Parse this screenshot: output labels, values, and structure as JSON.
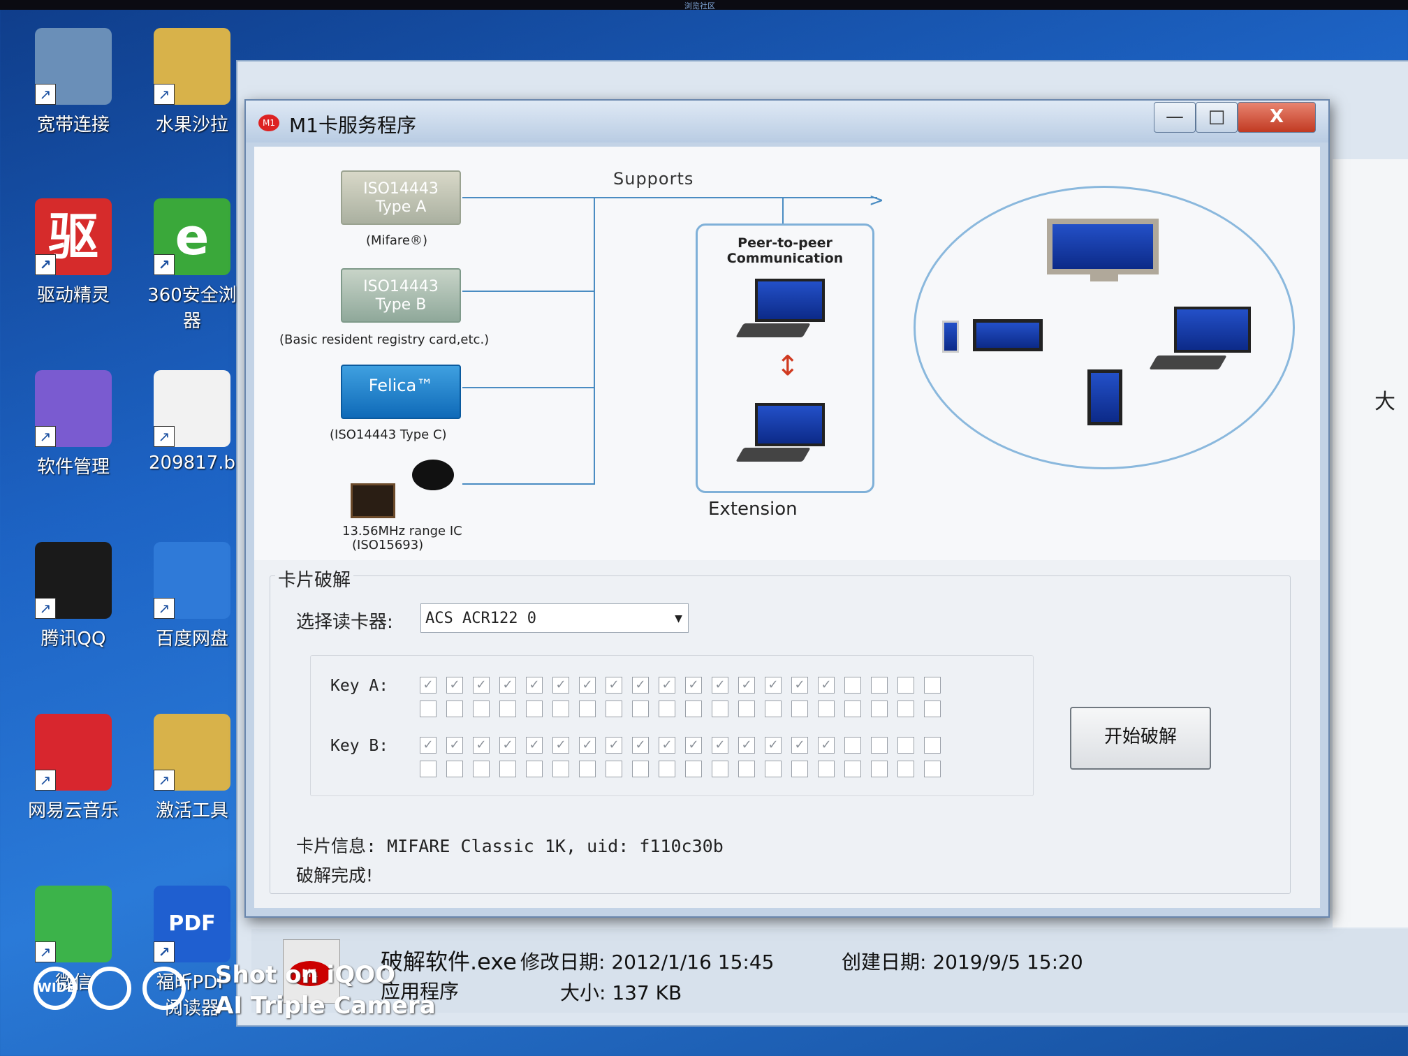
{
  "topbar_text": "浏览社区",
  "desktop": {
    "icons": [
      {
        "label": "宽带连接",
        "icon": "network-icon"
      },
      {
        "label": "水果沙拉",
        "icon": "folder-icon"
      },
      {
        "label": "驱动精灵",
        "icon": "driver-app-icon",
        "glyph": "驱"
      },
      {
        "label": "360安全浏",
        "label2": "器",
        "icon": "browser-360-icon",
        "glyph": "e"
      },
      {
        "label": "软件管理",
        "icon": "software-manager-icon"
      },
      {
        "label": "209817.b",
        "icon": "file-icon"
      },
      {
        "label": "腾讯QQ",
        "icon": "qq-icon"
      },
      {
        "label": "百度网盘",
        "icon": "baidu-netdisk-icon"
      },
      {
        "label": "网易云音乐",
        "icon": "netease-music-icon"
      },
      {
        "label": "激活工具",
        "icon": "folder-icon"
      },
      {
        "label": "微信",
        "icon": "wechat-icon"
      },
      {
        "label": "福昕PDF",
        "label2": "阅读器",
        "icon": "pdf-reader-icon",
        "glyph": "PDF"
      }
    ]
  },
  "background_window": {
    "side_char": "大"
  },
  "dialog": {
    "title": "M1卡服务程序",
    "app_icon": "card-app-icon",
    "window_buttons": {
      "minimize": "—",
      "maximize": "□",
      "close": "X"
    },
    "banner": {
      "supports": "Supports",
      "tags": [
        {
          "text1": "ISO14443",
          "text2": "Type A",
          "caption": "(Mifare®)"
        },
        {
          "text1": "ISO14443",
          "text2": "Type B",
          "caption": "(Basic resident registry card,etc.)"
        },
        {
          "text1": "Felica™",
          "caption": "(ISO14443 Type C)"
        }
      ],
      "ic_caption_1": "13.56MHz range IC",
      "ic_caption_2": "(ISO15693)",
      "p2p_1": "Peer-to-peer",
      "p2p_2": "Communication",
      "extension": "Extension"
    },
    "crack": {
      "group_title": "卡片破解",
      "reader_label": "选择读卡器:",
      "reader_value": "ACS ACR122 0",
      "key_a_label": "Key A:",
      "key_b_label": "Key B:",
      "key_a_rows": [
        [
          true,
          true,
          true,
          true,
          true,
          true,
          true,
          true,
          true,
          true,
          true,
          true,
          true,
          true,
          true,
          true,
          false,
          false,
          false,
          false
        ],
        [
          false,
          false,
          false,
          false,
          false,
          false,
          false,
          false,
          false,
          false,
          false,
          false,
          false,
          false,
          false,
          false,
          false,
          false,
          false,
          false
        ]
      ],
      "key_b_rows": [
        [
          true,
          true,
          true,
          true,
          true,
          true,
          true,
          true,
          true,
          true,
          true,
          true,
          true,
          true,
          true,
          true,
          false,
          false,
          false,
          false
        ],
        [
          false,
          false,
          false,
          false,
          false,
          false,
          false,
          false,
          false,
          false,
          false,
          false,
          false,
          false,
          false,
          false,
          false,
          false,
          false,
          false
        ]
      ],
      "start_button": "开始破解",
      "card_info": "卡片信息: MIFARE Classic 1K, uid: f110c30b",
      "status": "破解完成!"
    }
  },
  "file_info": {
    "name": "破解软件.exe",
    "type": "应用程序",
    "modified": "修改日期: 2012/1/16 15:45",
    "created": "创建日期: 2019/9/5 15:20",
    "size": "大小: 137 KB"
  },
  "watermark": {
    "wide": "WIDE",
    "line1": "Shot on iQOO",
    "line2": "AI Triple Camera"
  }
}
